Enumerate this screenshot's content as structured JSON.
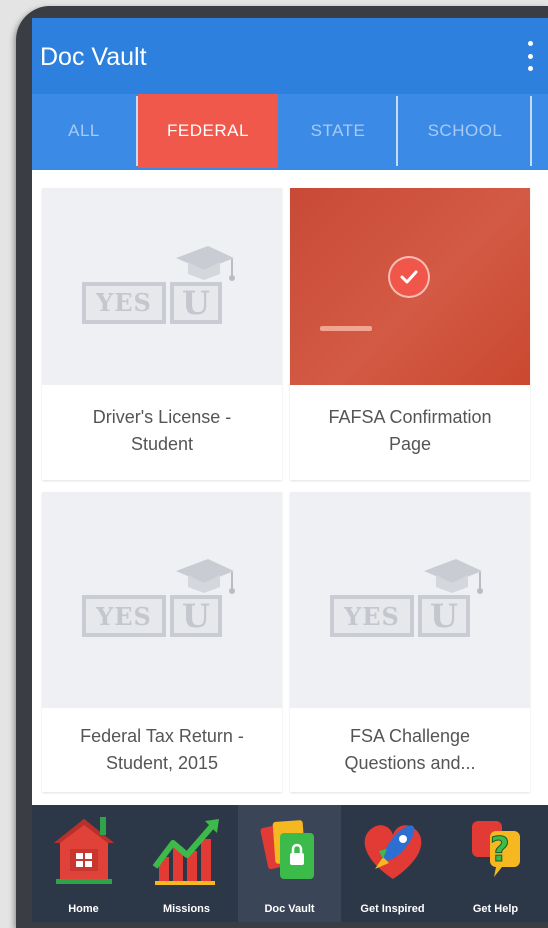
{
  "header": {
    "title": "Doc Vault"
  },
  "tabs": [
    {
      "label": "ALL",
      "active": false
    },
    {
      "label": "FEDERAL",
      "active": true
    },
    {
      "label": "STATE",
      "active": false
    },
    {
      "label": "SCHOOL",
      "active": false
    }
  ],
  "logo": {
    "yes": "YES",
    "u": "U"
  },
  "documents": [
    {
      "label": "Driver's License - Student",
      "selected": false
    },
    {
      "label": "FAFSA Confirmation Page",
      "selected": true
    },
    {
      "label": "Federal Tax Return - Student, 2015",
      "selected": false
    },
    {
      "label": "FSA Challenge Questions and...",
      "selected": false
    }
  ],
  "nav": [
    {
      "label": "Home",
      "icon": "home-icon"
    },
    {
      "label": "Missions",
      "icon": "chart-icon"
    },
    {
      "label": "Doc Vault",
      "icon": "doc-vault-icon",
      "active": true
    },
    {
      "label": "Get Inspired",
      "icon": "rocket-heart-icon"
    },
    {
      "label": "Get Help",
      "icon": "help-icon"
    }
  ],
  "colors": {
    "appbar": "#2e80de",
    "tabbar": "#3a8ae6",
    "active_tab": "#f1584c",
    "bottom_nav": "#2c3848"
  }
}
